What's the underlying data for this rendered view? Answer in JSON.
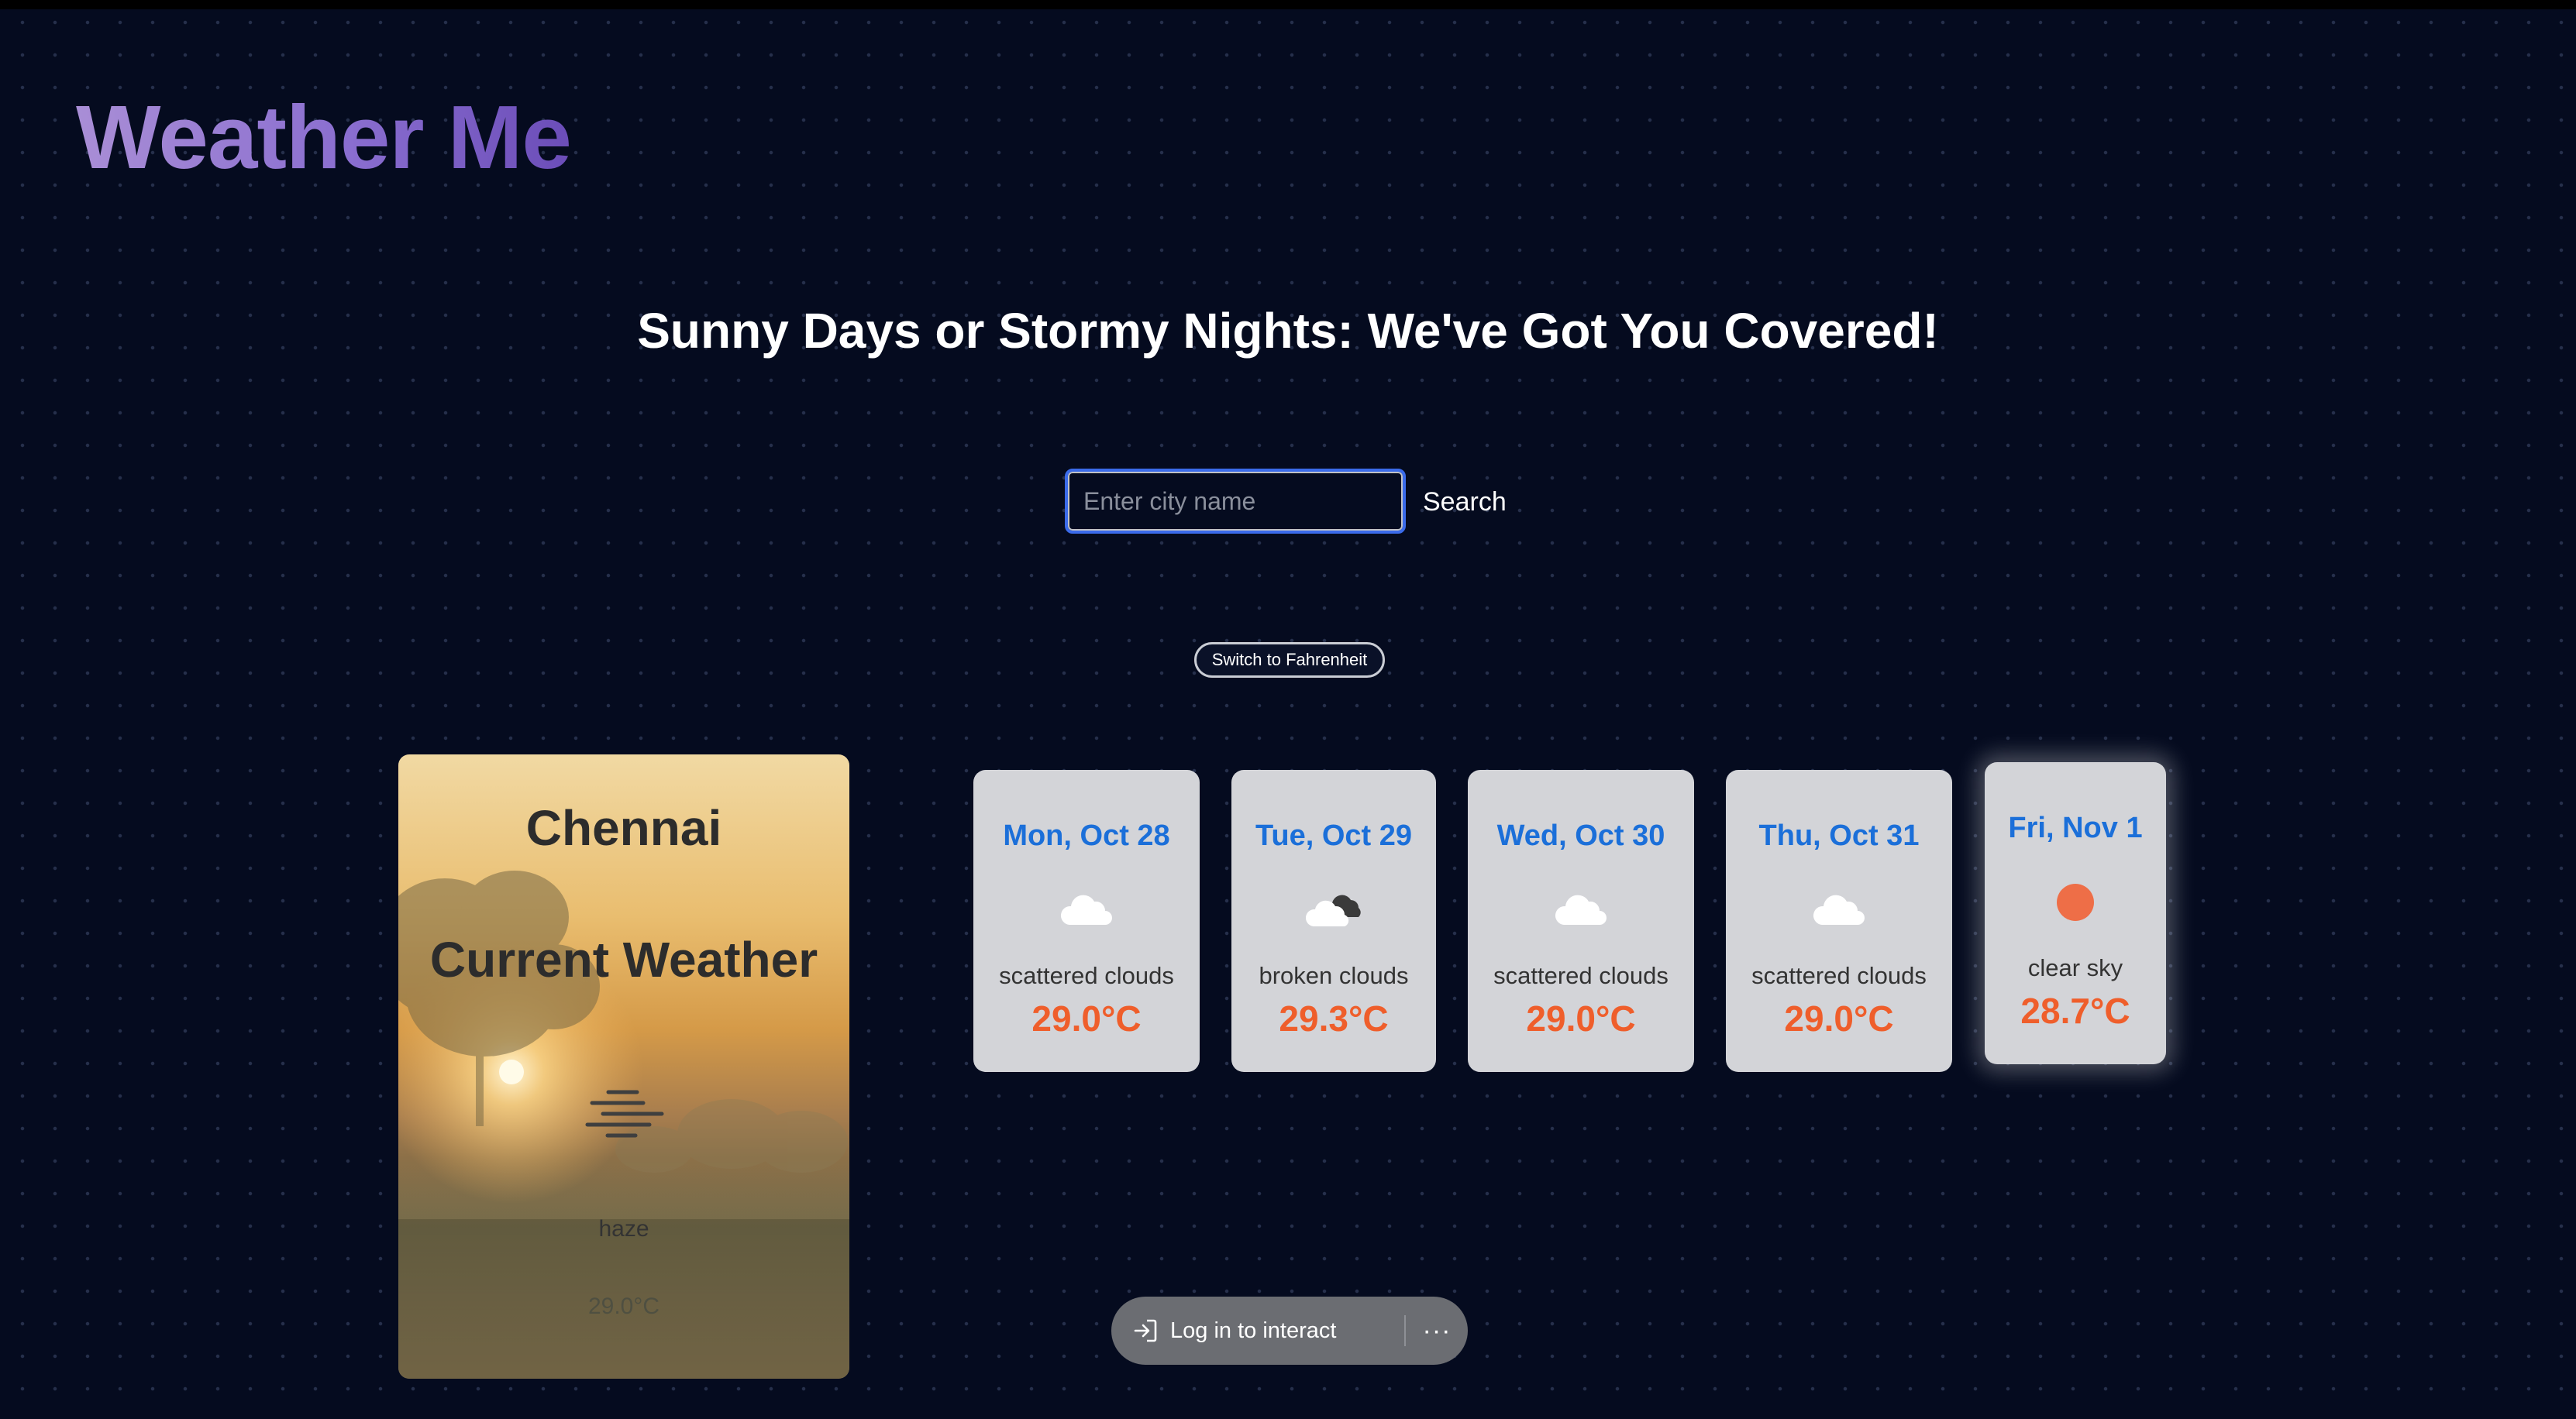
{
  "app": {
    "title": "Weather Me"
  },
  "hero": {
    "tagline": "Sunny Days or Stormy Nights: We've Got You Covered!"
  },
  "search": {
    "placeholder": "Enter city name",
    "value": "",
    "button_label": "Search"
  },
  "unit_toggle": {
    "label": "Switch to Fahrenheit"
  },
  "current": {
    "city": "Chennai",
    "heading": "Current Weather",
    "icon": "haze-icon",
    "condition": "haze",
    "temperature": "29.0°C"
  },
  "forecast": [
    {
      "date": "Mon, Oct 28",
      "icon": "scattered-clouds-icon",
      "condition": "scattered clouds",
      "temperature": "29.0°C"
    },
    {
      "date": "Tue, Oct 29",
      "icon": "broken-clouds-icon",
      "condition": "broken clouds",
      "temperature": "29.3°C"
    },
    {
      "date": "Wed, Oct 30",
      "icon": "scattered-clouds-icon",
      "condition": "scattered clouds",
      "temperature": "29.0°C"
    },
    {
      "date": "Thu, Oct 31",
      "icon": "scattered-clouds-icon",
      "condition": "scattered clouds",
      "temperature": "29.0°C"
    },
    {
      "date": "Fri, Nov 1",
      "icon": "clear-sky-icon",
      "condition": "clear sky",
      "temperature": "28.7°C"
    }
  ],
  "login_bar": {
    "label": "Log in to interact",
    "more": "···"
  },
  "colors": {
    "background": "#050b1f",
    "accent_blue": "#1b6fd9",
    "temperature_orange": "#ef5e2b",
    "card_gray": "#d3d4d8",
    "logo_purple": "#8a6ed0"
  }
}
